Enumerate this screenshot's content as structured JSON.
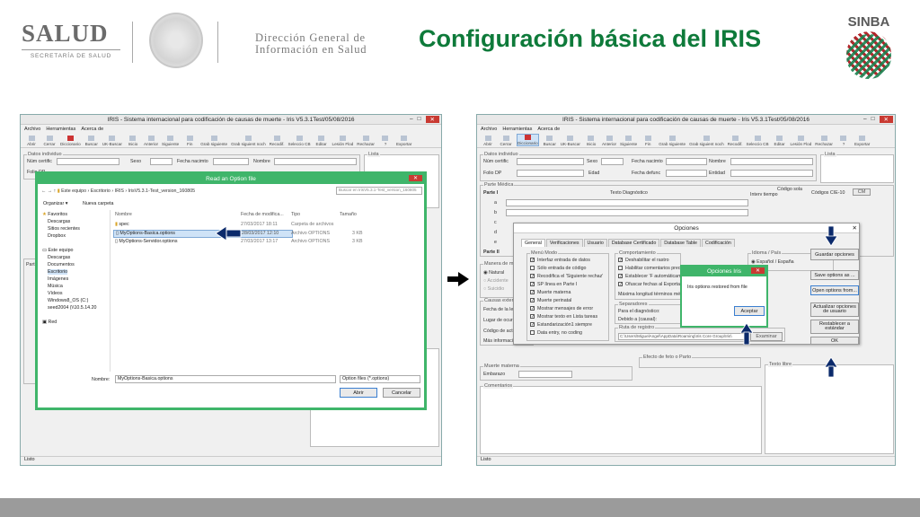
{
  "header": {
    "salud_big": "SALUD",
    "salud_small": "SECRETARÍA DE SALUD",
    "dgis_line1": "Dirección General de",
    "dgis_line2": "Información en Salud",
    "slide_title": "Configuración básica del IRIS",
    "sinba": "SINBA"
  },
  "iris": {
    "title": "IRIS - Sistema internacional para codificación de causas de muerte - Iris V5.3.1Test/05/08/2016",
    "menu": [
      "Archivo",
      "Herramientas",
      "Acerca de"
    ],
    "toolbar": [
      "Abrir",
      "Cerrar",
      "Diccionario",
      "Buscar",
      "UK-Buscar",
      "Inicio",
      "Anterior",
      "Siguiente",
      "Fin",
      "Grab siguiente",
      "Grab siguient noch",
      "Recodif.",
      "Seleccio CB",
      "Editar",
      "Lesión Flod",
      "Rechazar",
      "?",
      "Exportar"
    ],
    "left_toolbar_short": [
      "Abrir",
      "Cerrar",
      "Diccionario",
      "Buscar",
      "UK-Buscar",
      "Inicio",
      "Anterior",
      "Siguiente",
      "Fin",
      "Grab siguiente",
      "Grab siguient noch",
      "Recodif.",
      "Seleccio CB",
      "Editar",
      "Lesión Flod",
      "Rechazar",
      "?",
      "Exportar"
    ],
    "datos_individuo": "Datos individuo",
    "num_certific": "Núm certific",
    "sexo": "Sexo",
    "fecha_nacim": "Fecha nacimto",
    "nombre": "Nombre",
    "folio_dp": "Folio DP",
    "edad": "Edad",
    "fecha_defunc": "Fecha defunc",
    "entidad": "Entidad",
    "lista": "Lista",
    "parte_medica": "Parte Médica",
    "parte_i": "Parte I",
    "texto_diag": "Texto Diagnóstico",
    "intervalo": "Interv tiempo",
    "codigo_sola": "Código sola",
    "codigos_cie": "Códigos CIE-10",
    "cm": "CM",
    "rows_abc": [
      "a",
      "b",
      "c",
      "d",
      "e"
    ],
    "parte_ii": "Parte II",
    "manera_muerte": "Manera de muerte",
    "natural": "Natural",
    "accidente": "Accidente",
    "suicidio": "Suicidio",
    "causas_externas": "Causas externas",
    "fecha_lesion": "Fecha de la lesión",
    "lugar_ocurrencia": "Lugar de ocurr",
    "codigo_actividad": "Código de act",
    "mas_info": "Más información",
    "muerte_materna": "Muerte materna",
    "embarazo": "Embarazo",
    "comentarios": "Comentarios",
    "texto_libre": "Texto libre",
    "feto_parto": "Efecto de feto o Parto",
    "status": "Listo"
  },
  "open_dialog": {
    "title": "Read an Option file",
    "breadcrumb": [
      "Este equipo",
      "Escritorio",
      "IRIS",
      "IrisV5.3.1-Test_version_160805"
    ],
    "search_placeholder": "Buscar en IrisV5.3.1-Test_version_160805",
    "organize": "Organizar ▾",
    "new_folder": "Nueva carpeta",
    "columns": [
      "Nombre",
      "Fecha de modifica...",
      "Tipo",
      "Tamaño"
    ],
    "files": [
      {
        "name": "spec",
        "date": "27/03/2017 18:11",
        "type": "Carpeta de archivos",
        "size": ""
      },
      {
        "name": "MyOptions-Basica.options",
        "date": "28/03/2017 12:10",
        "type": "Archivo OPTIONS",
        "size": "3 KB"
      },
      {
        "name": "MyOptions-Servidor.options",
        "date": "27/03/2017 13:17",
        "type": "Archivo OPTIONS",
        "size": "3 KB"
      }
    ],
    "nav": [
      "Favoritos",
      "Descargas",
      "Sitios recientes",
      "Dropbox",
      "Este equipo",
      "Descargas",
      "Documentos",
      "Escritorio",
      "Imágenes",
      "Música",
      "Vídeos",
      "Windows8_OS (C:)",
      "seed2004 (\\\\10.5.14.20",
      "Red"
    ],
    "filename_label": "Nombre:",
    "filename_value": "MyOptions-Basica.options",
    "filter": "Option files (*.options)",
    "open_btn": "Abrir",
    "cancel_btn": "Cancelar"
  },
  "opciones": {
    "title": "Opciones",
    "tabs": [
      "General",
      "Verificaciones",
      "Usuario",
      "Database Certificado",
      "Database Table",
      "Codificación"
    ],
    "menu_modo": "Menú Modo",
    "modo_items": [
      {
        "label": "Interfaz entrada de datos",
        "checked": true
      },
      {
        "label": "Sólo entrada de código",
        "checked": false
      },
      {
        "label": "Recodifica el 'Siguiente rechaz'",
        "checked": true
      },
      {
        "label": "SP línea en Parte I",
        "checked": true
      },
      {
        "label": "Muerte materna",
        "checked": true
      },
      {
        "label": "Muerte perinatal",
        "checked": true
      },
      {
        "label": "Mostrar mensajes de error",
        "checked": true
      },
      {
        "label": "Mostrar texto en Lista tareas",
        "checked": true
      },
      {
        "label": "Estandarización1 siempre",
        "checked": true
      },
      {
        "label": "Data entry, no coding",
        "checked": false
      }
    ],
    "comportamiento": "Comportamiento",
    "comp_items": [
      {
        "label": "Deshabilitar el rastro",
        "checked": true
      },
      {
        "label": "Habilitar comentarios pred",
        "checked": false
      },
      {
        "label": "Establecer 'F automáticam",
        "checked": true
      },
      {
        "label": "Ofuscar fechas al Exportar",
        "checked": true
      }
    ],
    "max_longitud": "Máxima longitud términos méd",
    "separadores": "Separadores",
    "para_diag": "Para el diagnóstico:",
    "debido_a": "Debido a (causal):",
    "ruta_registro": "Ruta de registro",
    "ruta_value": "C:\\Users\\MiguelAngel\\AppData\\Roaming\\Iris Core Group\\Iris\\",
    "examinar": "Examinar",
    "idioma_pais": "Idioma / País",
    "idioma_value": "Español / España",
    "guardar_opciones": "Guardar opciones",
    "save_as": "Save options as ...",
    "open_from": "Open options from...",
    "actualizar": "Actualizar opciones de usuario",
    "restablecer": "Restablecer a estándar",
    "ok": "OK"
  },
  "opciones_iris": {
    "title": "Opciones Iris",
    "message": "Iris options restored from file",
    "aceptar": "Aceptar"
  }
}
